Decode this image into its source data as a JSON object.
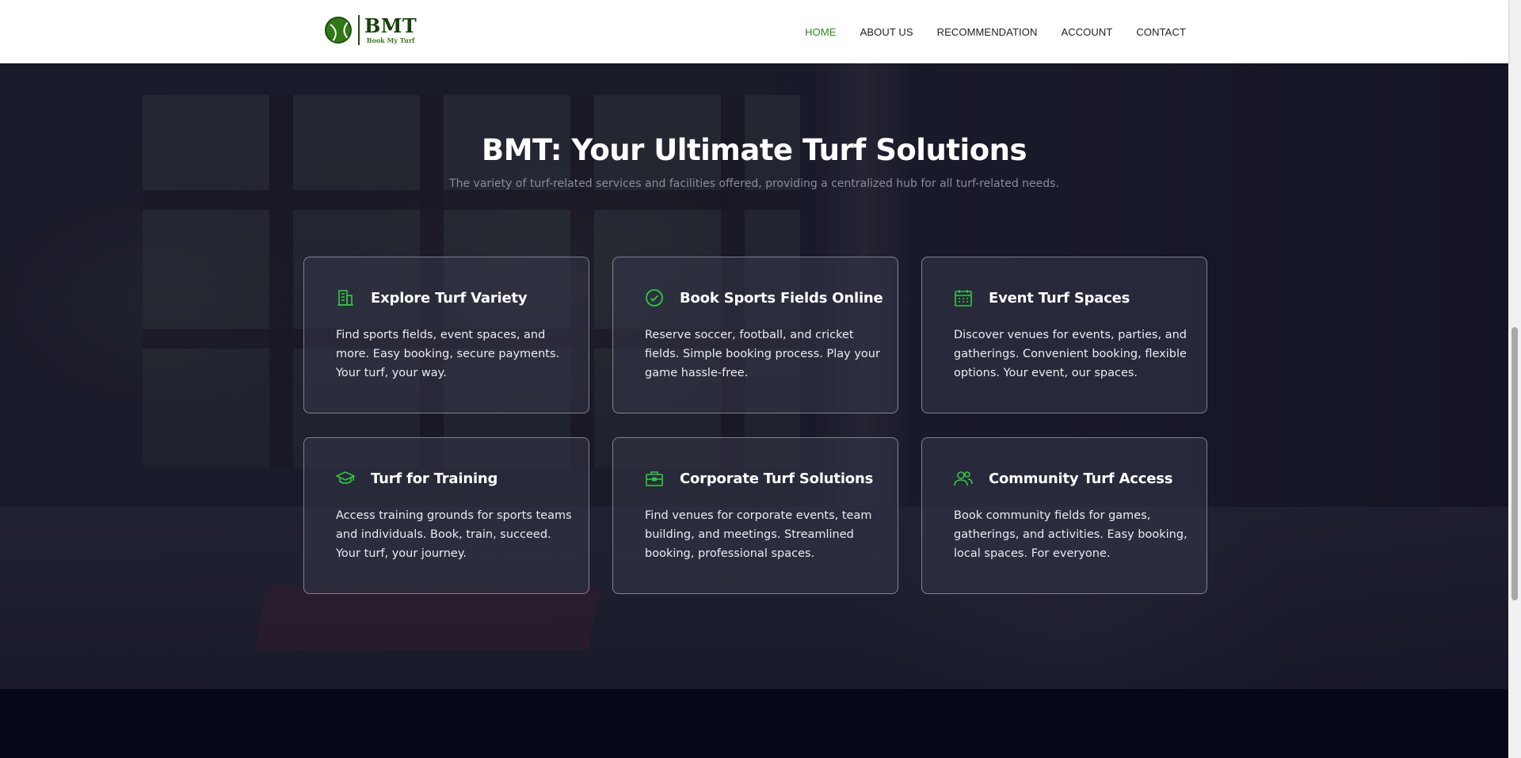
{
  "header": {
    "logo": {
      "title": "BMT",
      "subtitle": "Book My Turf"
    },
    "nav": [
      {
        "label": "HOME",
        "active": true
      },
      {
        "label": "ABOUT US",
        "active": false
      },
      {
        "label": "RECOMMENDATION",
        "active": false
      },
      {
        "label": "ACCOUNT",
        "active": false
      },
      {
        "label": "CONTACT",
        "active": false
      }
    ]
  },
  "hero": {
    "title": "BMT: Your Ultimate Turf Solutions",
    "subtitle": "The variety of turf-related services and facilities offered, providing a centralized hub for all turf-related needs."
  },
  "cards": [
    {
      "icon": "building-icon",
      "title": "Explore Turf Variety",
      "text": "Find sports fields, event spaces, and more. Easy booking, secure payments. Your turf, your way."
    },
    {
      "icon": "check-circle-icon",
      "title": "Book Sports Fields Online",
      "text": "Reserve soccer, football, and cricket fields. Simple booking process. Play your game hassle-free."
    },
    {
      "icon": "calendar-icon",
      "title": "Event Turf Spaces",
      "text": "Discover venues for events, parties, and gatherings. Convenient booking, flexible options. Your event, our spaces."
    },
    {
      "icon": "graduation-cap-icon",
      "title": "Turf for Training",
      "text": "Access training grounds for sports teams and individuals. Book, train, succeed. Your turf, your journey."
    },
    {
      "icon": "briefcase-icon",
      "title": "Corporate Turf Solutions",
      "text": "Find venues for corporate events, team building, and meetings. Streamlined booking, professional spaces."
    },
    {
      "icon": "people-icon",
      "title": "Community Turf Access",
      "text": "Book community fields for games, gatherings, and activities. Easy booking, local spaces. For everyone."
    }
  ],
  "colors": {
    "accent": "#2ECC40",
    "nav_active": "#2a8c1c",
    "header_bg": "#ffffff",
    "bottom_bg": "#050818"
  }
}
